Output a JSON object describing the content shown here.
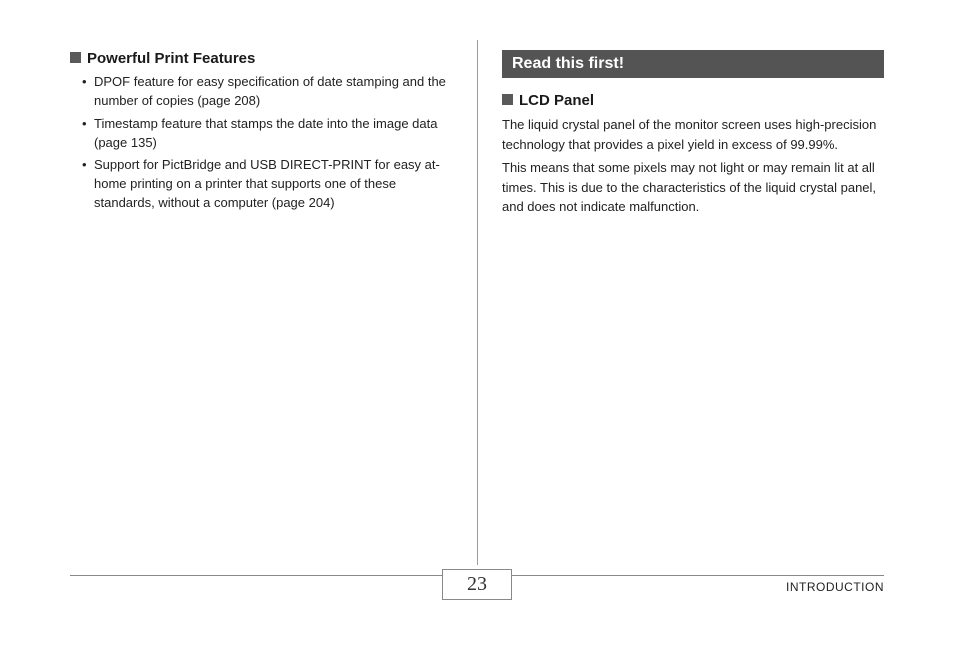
{
  "left": {
    "heading": "Powerful Print Features",
    "bullets": [
      "DPOF feature for easy specification of date stamping and the number of copies (page 208)",
      "Timestamp feature that stamps the date into the image data (page 135)",
      "Support for PictBridge and USB DIRECT-PRINT for easy at-home printing on a printer that supports one of these standards, without a computer (page 204)"
    ]
  },
  "right": {
    "banner": "Read this first!",
    "heading": "LCD Panel",
    "para1": "The liquid crystal panel of the monitor screen uses high-precision technology that provides a pixel yield in excess of 99.99%.",
    "para2": "This means that some pixels may not light or may remain lit at all times. This is due to the characteristics of the liquid crystal panel, and does not indicate malfunction."
  },
  "footer": {
    "page_number": "23",
    "section": "INTRODUCTION"
  }
}
